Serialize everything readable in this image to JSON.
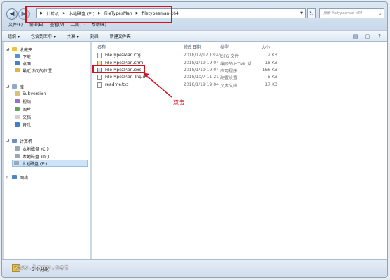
{
  "address": {
    "breadcrumbs": [
      "计算机",
      "本地磁盘 (E:)",
      "FileTypesMan",
      "filetypesman-x64"
    ],
    "search_placeholder": "搜索 filetypesman-x64"
  },
  "menu": [
    "文件(F)",
    "编辑(E)",
    "查看(V)",
    "工具(T)",
    "帮助(H)"
  ],
  "toolbar": [
    "组织 ▾",
    "包含到库中 ▾",
    "共享 ▾",
    "刻录",
    "新建文件夹"
  ],
  "navpane": {
    "favorites": {
      "label": "收藏夹",
      "items": [
        "下载",
        "桌面",
        "最近访问的位置"
      ]
    },
    "library": {
      "label": "库",
      "items": [
        "Subversion",
        "视频",
        "图片",
        "文档",
        "音乐"
      ]
    },
    "computer": {
      "label": "计算机",
      "items": [
        "本地磁盘 (C:)",
        "本地磁盘 (D:)",
        "本地磁盘 (E:)"
      ]
    },
    "network": {
      "label": "网络"
    }
  },
  "columns": {
    "name": "名称",
    "date": "修改日期",
    "type": "类型",
    "size": "大小"
  },
  "files": [
    {
      "name": "FileTypesMan.cfg",
      "date": "2018/12/17 13:45",
      "type": "CFG 文件",
      "size": "2 KB"
    },
    {
      "name": "FileTypesMan.chm",
      "date": "2018/1/19 19:04",
      "type": "编译的 HTML 帮...",
      "size": "18 KB"
    },
    {
      "name": "FileTypesMan.exe",
      "date": "2018/1/19 19:04",
      "type": "应用程序",
      "size": "166 KB"
    },
    {
      "name": "FileTypesMan_lng.ini",
      "date": "2018/10/7 11:21",
      "type": "配置设置",
      "size": "5 KB"
    },
    {
      "name": "readme.txt",
      "date": "2018/1/19 19:04",
      "type": "文本文档",
      "size": "17 KB"
    }
  ],
  "annotation": "双击",
  "status": {
    "count": "5 个对象"
  },
  "watermark": "www.laoy.net",
  "colors": {
    "highlight": "#d4121e",
    "selection": "#cde3f7"
  }
}
